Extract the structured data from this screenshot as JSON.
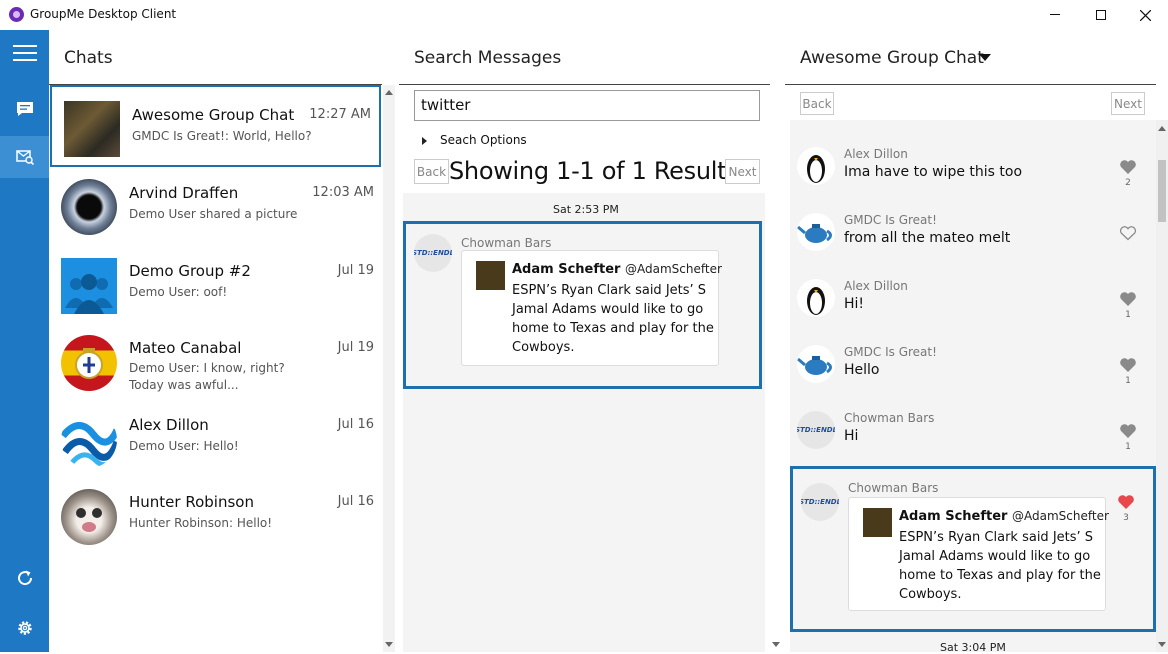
{
  "window": {
    "title": "GroupMe Desktop Client",
    "minimize": "—",
    "maximize": "☐",
    "close": "✕"
  },
  "chats_panel": {
    "title": "Chats",
    "items": [
      {
        "name": "Awesome Group Chat",
        "time": "12:27 AM",
        "preview": "GMDC Is Great!: World, Hello?"
      },
      {
        "name": "Arvind Draffen",
        "time": "12:03 AM",
        "preview": "Demo User shared a picture"
      },
      {
        "name": "Demo Group #2",
        "time": "Jul 19",
        "preview": "Demo User: oof!"
      },
      {
        "name": "Mateo Canabal",
        "time": "Jul 19",
        "preview": "Demo User: I know, right?",
        "preview2": "Today was awful..."
      },
      {
        "name": "Alex Dillon",
        "time": "Jul 16",
        "preview": "Demo User: Hello!"
      },
      {
        "name": "Hunter Robinson",
        "time": "Jul 16",
        "preview": "Hunter Robinson: Hello!"
      }
    ]
  },
  "search_panel": {
    "title": "Search Messages",
    "query": "twitter",
    "options_label": "Seach Options",
    "back": "Back",
    "next": "Next",
    "results_label": "Showing 1-1 of 1 Results",
    "day": "Sat 2:53 PM",
    "result": {
      "avatar_text": "STD::ENDL",
      "sender": "Chowman Bars",
      "card_author": "Adam Schefter",
      "card_handle": "@AdamSchefter",
      "card_lines": [
        "ESPN’s Ryan Clark said Jets’ S",
        "Jamal Adams would like to go",
        "home to Texas and play for the",
        "Cowboys."
      ]
    }
  },
  "conversation": {
    "title": "Awesome Group Chat",
    "back": "Back",
    "next": "Next",
    "messages": [
      {
        "sender": "Alex Dillon",
        "text": "Ima have to wipe this too",
        "likes": "2",
        "liked": false
      },
      {
        "sender": "GMDC Is Great!",
        "text": "from all the mateo melt",
        "likes": "",
        "liked": false
      },
      {
        "sender": "Alex Dillon",
        "text": "Hi!",
        "likes": "1",
        "liked": false
      },
      {
        "sender": "GMDC Is Great!",
        "text": "Hello",
        "likes": "1",
        "liked": false
      },
      {
        "sender": "Chowman Bars",
        "text": "Hi",
        "likes": "1",
        "liked": false
      }
    ],
    "highlighted": {
      "avatar_text": "STD::ENDL",
      "sender": "Chowman Bars",
      "likes": "3",
      "card_author": "Adam Schefter",
      "card_handle": "@AdamSchefter",
      "card_lines": [
        "ESPN’s Ryan Clark said Jets’ S",
        "Jamal Adams would like to go",
        "home to Texas and play for the",
        "Cowboys."
      ]
    },
    "footer_day": "Sat 3:04 PM"
  },
  "colors": {
    "sidebar": "#1f78c4",
    "accent": "#1e6fae",
    "liked_heart": "#e8474c",
    "heart": "#8a8a8a"
  }
}
